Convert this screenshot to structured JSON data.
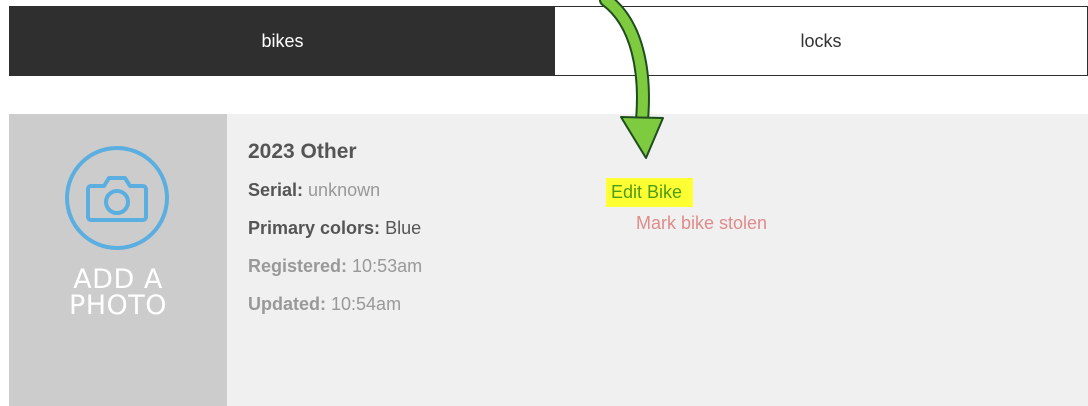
{
  "tabs": [
    {
      "label": "bikes",
      "active": true
    },
    {
      "label": "locks",
      "active": false
    }
  ],
  "bike": {
    "photo_placeholder": {
      "line1": "ADD A",
      "line2": "PHOTO"
    },
    "title": "2023 Other",
    "serial": {
      "label": "Serial:",
      "value": "unknown"
    },
    "primary_colors": {
      "label": "Primary colors:",
      "value": "Blue"
    },
    "registered": {
      "label": "Registered:",
      "value": "10:53am"
    },
    "updated": {
      "label": "Updated:",
      "value": "10:54am"
    },
    "actions": {
      "edit": "Edit Bike",
      "mark_stolen": "Mark bike stolen"
    }
  },
  "colors": {
    "tab_active_bg": "#2f2f2f",
    "edit_link": "#4d9d11",
    "edit_highlight": "#ffff33",
    "stolen_link": "#e08b8b",
    "camera_icon": "#5aaee0",
    "annotation_arrow": "#7ecb3f"
  },
  "icons": {
    "camera": "camera-icon",
    "annotation": "annotation-arrow-icon"
  }
}
